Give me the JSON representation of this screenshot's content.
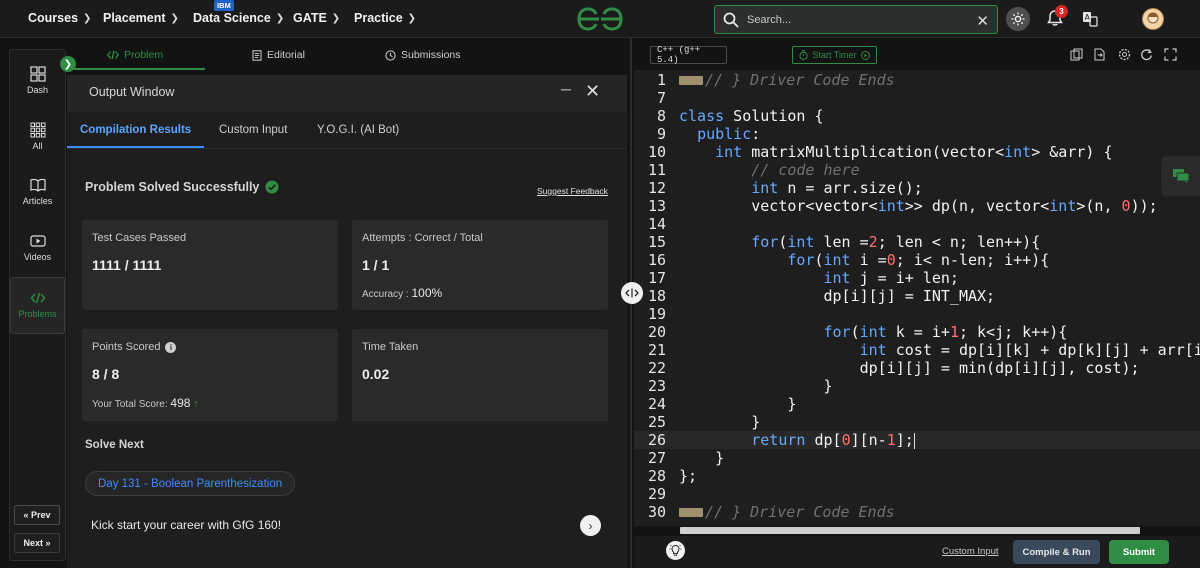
{
  "topnav": {
    "items": [
      {
        "label": "Courses"
      },
      {
        "label": "Placement"
      },
      {
        "label": "Data Science"
      },
      {
        "label": "GATE"
      },
      {
        "label": "Practice"
      }
    ],
    "badge": "IBM",
    "search_placeholder": "Search...",
    "notifications_count": "3",
    "brand_color": "#2f8d46"
  },
  "rail": {
    "items": [
      {
        "label": "Dash",
        "icon": "dashboard-icon"
      },
      {
        "label": "All",
        "icon": "grid-icon"
      },
      {
        "label": "Articles",
        "icon": "book-icon"
      },
      {
        "label": "Videos",
        "icon": "video-icon"
      },
      {
        "label": "Problems",
        "icon": "code-icon"
      }
    ],
    "prev": "Prev",
    "next": "Next"
  },
  "problem_tabs": [
    {
      "label": "Problem",
      "icon": "code-icon"
    },
    {
      "label": "Editorial",
      "icon": "document-icon"
    },
    {
      "label": "Submissions",
      "icon": "clock-icon"
    }
  ],
  "output": {
    "title": "Output Window",
    "tabs": [
      "Compilation Results",
      "Custom Input",
      "Y.O.G.I. (AI Bot)"
    ],
    "status": "Problem Solved Successfully",
    "feedback": "Suggest Feedback",
    "cards": {
      "tests": {
        "label": "Test Cases Passed",
        "value": "1111 / 1111"
      },
      "attempts": {
        "label": "Attempts : Correct / Total",
        "value": "1 / 1",
        "sub_label": "Accuracy :",
        "sub_value": "100%"
      },
      "points": {
        "label": "Points Scored",
        "value": "8 / 8",
        "sub_label": "Your Total Score:",
        "sub_value": "498"
      },
      "time": {
        "label": "Time Taken",
        "value": "0.02"
      }
    },
    "solve_next": "Solve Next",
    "next_problem": "Day 131 - Boolean Parenthesization",
    "promo": "Kick start your career with GfG 160!"
  },
  "editor": {
    "language": "C++ (g++ 5.4)",
    "timer": "Start Timer",
    "lines": [
      {
        "n": "1",
        "text": "// } Driver Code Ends"
      },
      {
        "n": "7",
        "text": ""
      },
      {
        "n": "8",
        "text": "class Solution {"
      },
      {
        "n": "9",
        "text": "  public:"
      },
      {
        "n": "10",
        "text": "    int matrixMultiplication(vector<int> &arr) {"
      },
      {
        "n": "11",
        "text": "        // code here"
      },
      {
        "n": "12",
        "text": "        int n = arr.size();"
      },
      {
        "n": "13",
        "text": "        vector<vector<int>> dp(n, vector<int>(n, 0));"
      },
      {
        "n": "14",
        "text": ""
      },
      {
        "n": "15",
        "text": "        for(int len =2; len < n; len++){"
      },
      {
        "n": "16",
        "text": "            for(int i =0; i< n-len; i++){"
      },
      {
        "n": "17",
        "text": "                int j = i+ len;"
      },
      {
        "n": "18",
        "text": "                dp[i][j] = INT_MAX;"
      },
      {
        "n": "19",
        "text": ""
      },
      {
        "n": "20",
        "text": "                for(int k = i+1; k<j; k++){"
      },
      {
        "n": "21",
        "text": "                    int cost = dp[i][k] + dp[k][j] + arr[i] *"
      },
      {
        "n": "22",
        "text": "                    dp[i][j] = min(dp[i][j], cost);"
      },
      {
        "n": "23",
        "text": "                }"
      },
      {
        "n": "24",
        "text": "            }"
      },
      {
        "n": "25",
        "text": "        }"
      },
      {
        "n": "26",
        "text": "        return dp[0][n-1];"
      },
      {
        "n": "27",
        "text": "    }"
      },
      {
        "n": "28",
        "text": "};"
      },
      {
        "n": "29",
        "text": ""
      },
      {
        "n": "30",
        "text": "// } Driver Code Ends"
      }
    ],
    "custom_input": "Custom Input",
    "compile_run": "Compile & Run",
    "submit": "Submit"
  }
}
